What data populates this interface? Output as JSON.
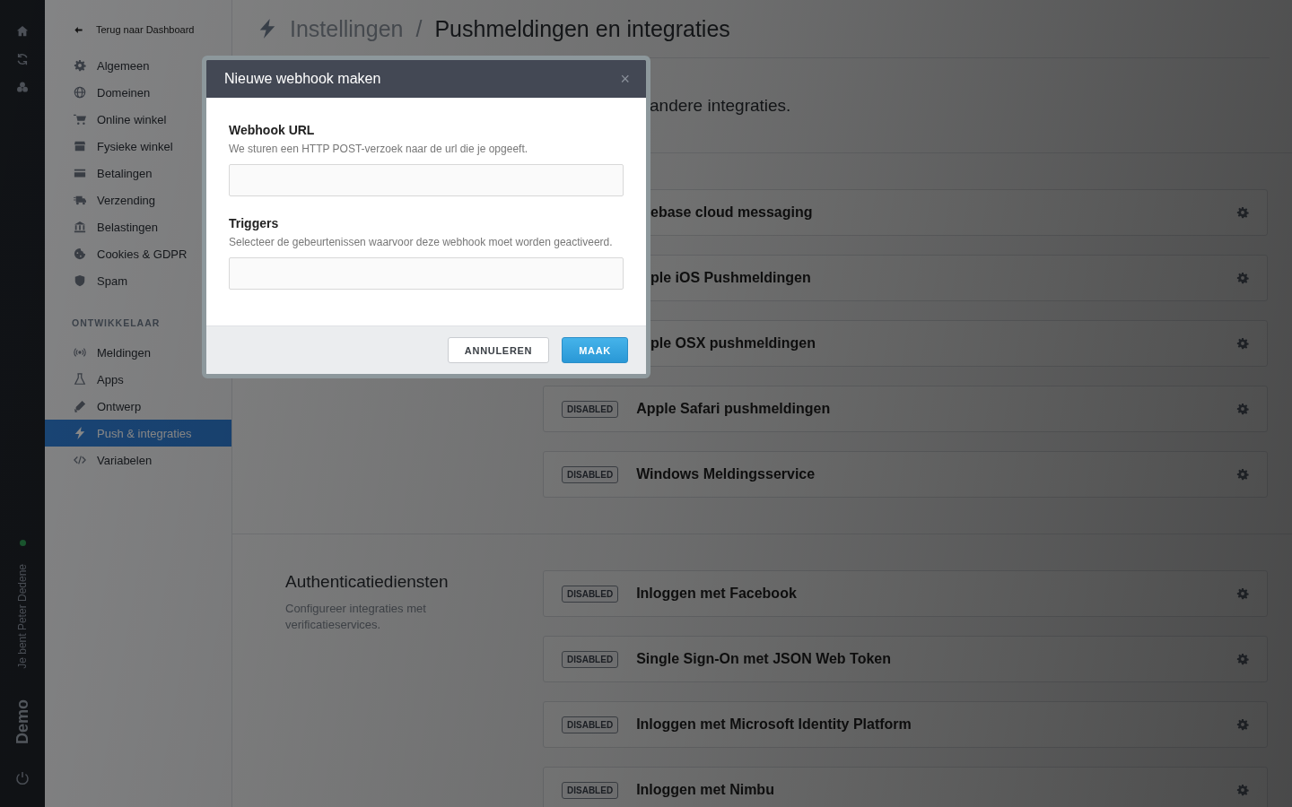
{
  "rail": {
    "online": true,
    "user": "Je bent Peter Dedene",
    "site": "Demo"
  },
  "nav": {
    "back": "Terug naar Dashboard",
    "items": [
      {
        "label": "Algemeen",
        "selected": false
      },
      {
        "label": "Domeinen",
        "selected": false
      },
      {
        "label": "Online winkel",
        "selected": false
      },
      {
        "label": "Fysieke winkel",
        "selected": false
      },
      {
        "label": "Betalingen",
        "selected": false
      },
      {
        "label": "Verzending",
        "selected": false
      },
      {
        "label": "Belastingen",
        "selected": false
      },
      {
        "label": "Cookies & GDPR",
        "selected": false
      },
      {
        "label": "Spam",
        "selected": false
      }
    ],
    "developer_heading": "ONTWIKKELAAR",
    "developer_items": [
      {
        "label": "Meldingen",
        "selected": false
      },
      {
        "label": "Apps",
        "selected": false
      },
      {
        "label": "Ontwerp",
        "selected": false
      },
      {
        "label": "Push & integraties",
        "selected": true
      },
      {
        "label": "Variabelen",
        "selected": false
      }
    ]
  },
  "page": {
    "breadcrumb_parent": "Instellingen",
    "breadcrumb_separator": "/",
    "title": "Pushmeldingen en integraties",
    "intro": "andere integraties.",
    "sections": [
      {
        "integrations": [
          {
            "title": "ebase cloud messaging"
          },
          {
            "title": "ple iOS Pushmeldingen"
          },
          {
            "title": "ple OSX pushmeldingen"
          },
          {
            "status": "DISABLED",
            "title": "Apple Safari pushmeldingen"
          },
          {
            "status": "DISABLED",
            "title": "Windows Meldingsservice"
          }
        ]
      },
      {
        "heading": "Authenticatiediensten",
        "description": "Configureer integraties met verificatieservices.",
        "integrations": [
          {
            "status": "DISABLED",
            "title": "Inloggen met Facebook"
          },
          {
            "status": "DISABLED",
            "title": "Single Sign-On met JSON Web Token"
          },
          {
            "status": "DISABLED",
            "title": "Inloggen met Microsoft Identity Platform"
          },
          {
            "status": "DISABLED",
            "title": "Inloggen met Nimbu"
          }
        ]
      }
    ]
  },
  "dialog": {
    "title": "Nieuwe webhook maken",
    "close": "×",
    "fields": [
      {
        "label": "Webhook URL",
        "help": "We sturen een HTTP POST-verzoek naar de url die je opgeeft."
      },
      {
        "label": "Triggers",
        "help": "Selecteer de gebeurtenissen waarvoor deze webhook moet worden geactiveerd."
      }
    ],
    "buttons": [
      {
        "label": "ANNULEREN",
        "kind": "secondary"
      },
      {
        "label": "MAAK",
        "kind": "primary"
      }
    ]
  }
}
